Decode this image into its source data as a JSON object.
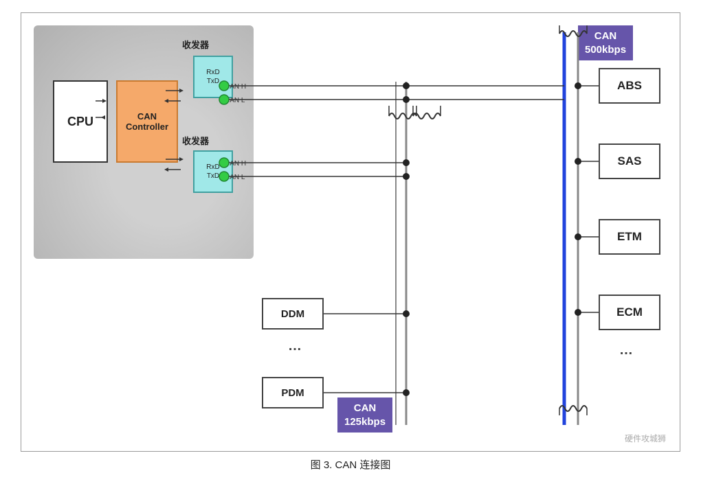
{
  "diagram": {
    "title": "图 3.   CAN 连接图",
    "left_area": {
      "cpu_label": "CPU",
      "can_ctrl_label": "CAN\nController",
      "transceiver_top_label": "收发器",
      "transceiver_bottom_label": "收发器",
      "transceiver_rxd": "RxD",
      "transceiver_txd": "TxD",
      "canh_label": "CAN H",
      "canl_label": "CAN L"
    },
    "right_boxes": [
      "ABS",
      "SAS",
      "ETM",
      "ECM"
    ],
    "bottom_boxes": [
      "DDM",
      "PDM"
    ],
    "can_500_label": "CAN\n500kbps",
    "can_125_label": "CAN\n125kbps",
    "dots_right": "…",
    "dots_bottom": "…",
    "watermark": "硬件攻城狮"
  }
}
